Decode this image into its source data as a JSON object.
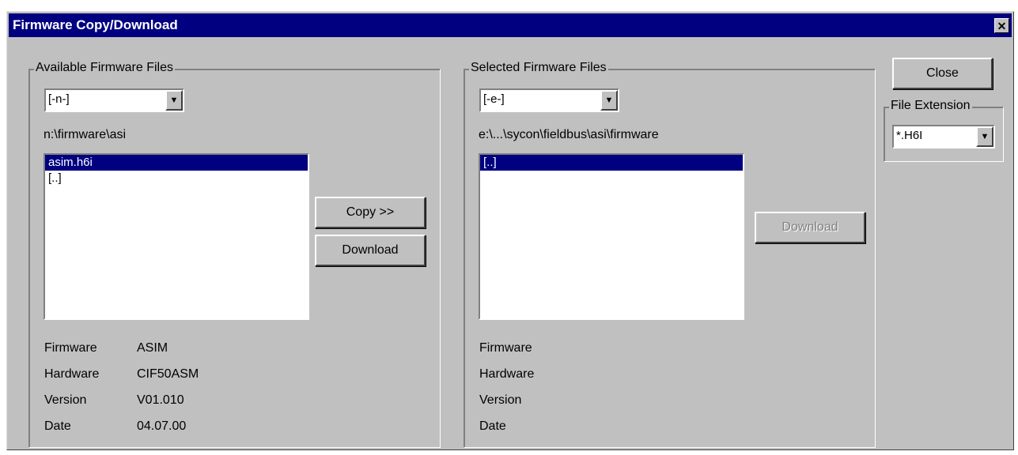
{
  "window": {
    "title": "Firmware Copy/Download"
  },
  "available": {
    "group_label": "Available Firmware Files",
    "drive": "[-n-]",
    "path": "n:\\firmware\\asi",
    "files": [
      "asim.h6i",
      "[..]"
    ],
    "info_labels": [
      "Firmware",
      "Hardware",
      "Version",
      "Date"
    ],
    "info_values": [
      "ASIM",
      "CIF50ASM",
      "V01.010",
      "04.07.00"
    ]
  },
  "buttons": {
    "copy": "Copy >>",
    "download": "Download",
    "download_right": "Download",
    "close": "Close"
  },
  "selected": {
    "group_label": "Selected Firmware Files",
    "drive": "[-e-]",
    "path": "e:\\...\\sycon\\fieldbus\\asi\\firmware",
    "files": [
      "[..]"
    ],
    "info_labels": [
      "Firmware",
      "Hardware",
      "Version",
      "Date"
    ]
  },
  "extension": {
    "group_label": "File Extension",
    "value": "*.H6I"
  }
}
